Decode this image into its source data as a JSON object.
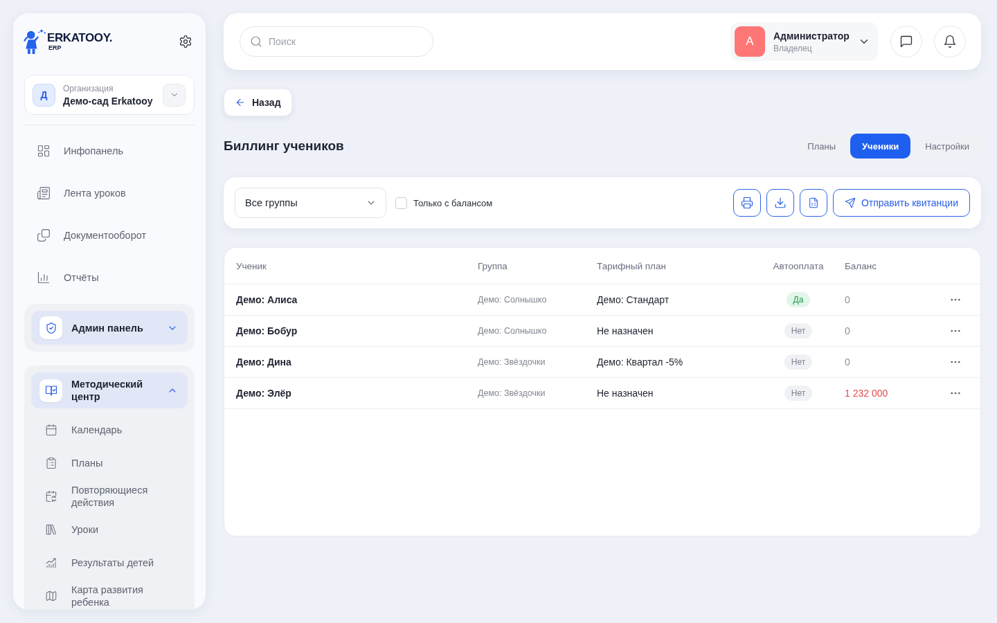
{
  "sidebar": {
    "logo": {
      "wordmark": "ERKATOOY.",
      "subtitle": "ERP"
    },
    "organization": {
      "avatar": "Д",
      "label": "Организация",
      "name": "Демо-сад Erkatooy"
    },
    "nav": [
      {
        "label": "Инфопанель"
      },
      {
        "label": "Лента уроков"
      },
      {
        "label": "Документооборот"
      },
      {
        "label": "Отчёты"
      }
    ],
    "groups": [
      {
        "label": "Админ панель",
        "expanded": false
      },
      {
        "label": "Методический центр",
        "expanded": true,
        "children": [
          {
            "label": "Календарь"
          },
          {
            "label": "Планы"
          },
          {
            "label": "Повторяющиеся действия"
          },
          {
            "label": "Уроки"
          },
          {
            "label": "Результаты детей"
          },
          {
            "label": "Карта развития ребенка"
          }
        ]
      }
    ]
  },
  "header": {
    "search": {
      "placeholder": "Поиск"
    },
    "user": {
      "avatar": "А",
      "name": "Администратор",
      "role": "Владелец"
    }
  },
  "back_button": "Назад",
  "page": {
    "title": "Биллинг учеников",
    "tabs": [
      {
        "label": "Планы",
        "selected": false
      },
      {
        "label": "Ученики",
        "selected": true
      },
      {
        "label": "Настройки",
        "selected": false
      }
    ]
  },
  "filters": {
    "group_select": "Все группы",
    "balance_only": {
      "label": "Только с балансом",
      "checked": false
    },
    "send_button": "Отправить квитанции"
  },
  "table": {
    "columns": [
      "Ученик",
      "Группа",
      "Тарифный план",
      "Автооплата",
      "Баланс"
    ],
    "rows": [
      {
        "student": "Демо: Алиса",
        "group": "Демо: Солнышко",
        "plan": "Демо: Стандарт",
        "autopay": {
          "label": "Да",
          "on": true
        },
        "balance": "0",
        "debt": false
      },
      {
        "student": "Демо: Бобур",
        "group": "Демо: Солнышко",
        "plan": "Не назначен",
        "autopay": {
          "label": "Нет",
          "on": false
        },
        "balance": "0",
        "debt": false
      },
      {
        "student": "Демо: Дина",
        "group": "Демо: Звёздочки",
        "plan": "Демо: Квартал -5%",
        "autopay": {
          "label": "Нет",
          "on": false
        },
        "balance": "0",
        "debt": false
      },
      {
        "student": "Демо: Элёр",
        "group": "Демо: Звёздочки",
        "plan": "Не назначен",
        "autopay": {
          "label": "Нет",
          "on": false
        },
        "balance": "1 232 000",
        "debt": true
      }
    ]
  }
}
